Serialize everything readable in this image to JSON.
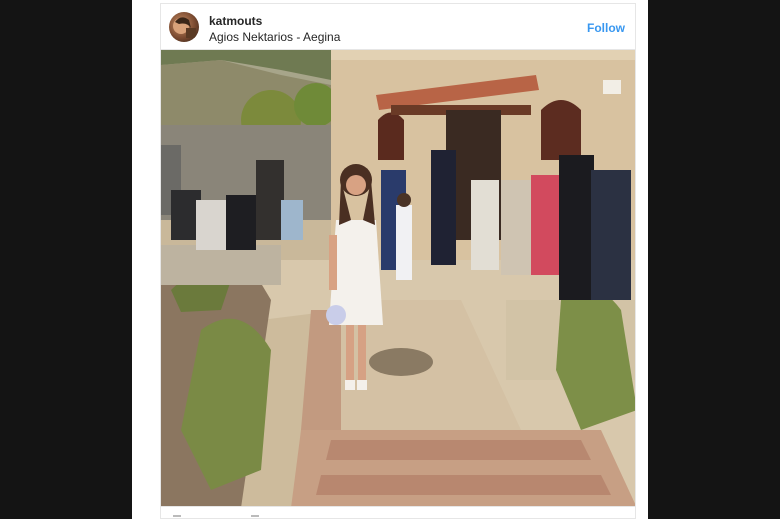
{
  "post": {
    "username": "katmouts",
    "location": "Agios Nektarios - Aegina",
    "follow_label": "Follow"
  },
  "colors": {
    "follow": "#3897f0",
    "background": "#141414",
    "card": "#ffffff"
  },
  "icons": {
    "avatar": "profile-avatar",
    "footer_left": "heart-icon",
    "footer_right": "comment-icon"
  }
}
